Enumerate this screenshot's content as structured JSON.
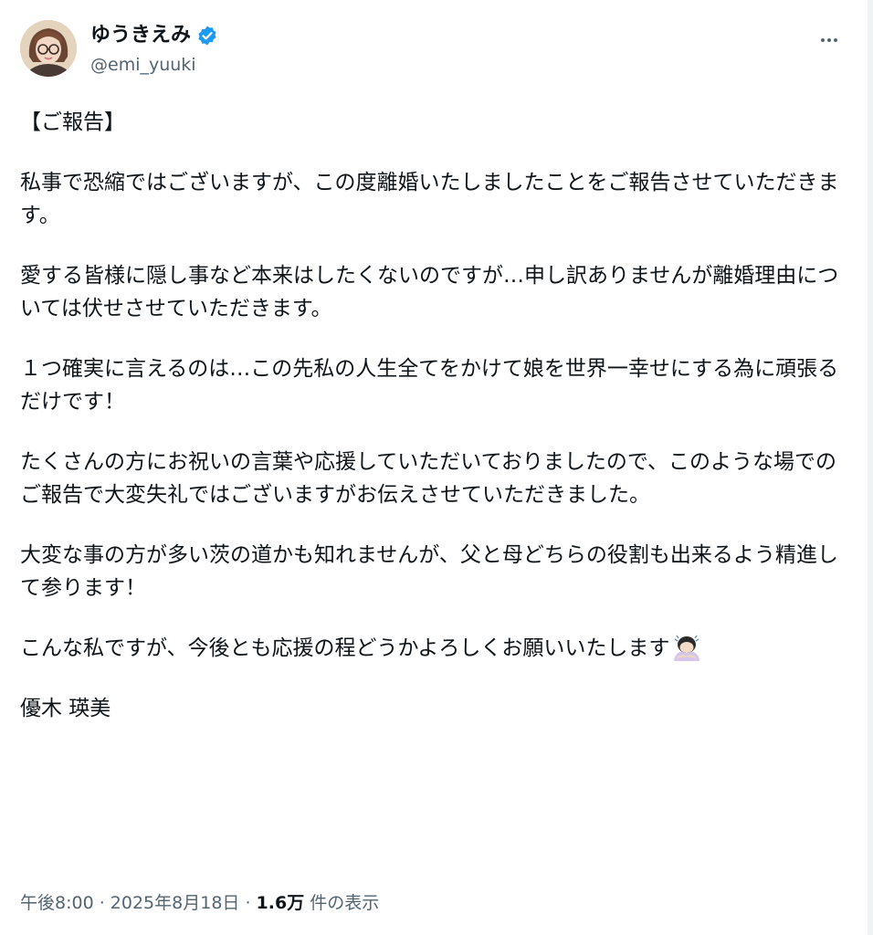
{
  "author": {
    "display_name": "ゆうきえみ",
    "handle": "@emi_yuuki",
    "avatar_icon": "profile-photo",
    "verified_icon": "verified-badge-icon",
    "verified_color": "#1d9bf0"
  },
  "menu": {
    "icon": "more-options-icon"
  },
  "post": {
    "heading": "【ご報告】",
    "paragraphs": [
      "私事で恐縮ではございますが、この度離婚いたしましたことをご報告させていただきます。",
      "愛する皆様に隠し事など本来はしたくないのですが…申し訳ありませんが離婚理由については伏せさせていただきます。",
      "１つ確実に言えるのは…この先私の人生全てをかけて娘を世界一幸せにする為に頑張るだけです！",
      "たくさんの方にお祝いの言葉や応援していただいておりましたので、このような場でのご報告で大変失礼ではございますがお伝えさせていただきました。",
      "大変な事の方が多い茨の道かも知れませんが、父と母どちらの役割も出来るよう精進して参ります！"
    ],
    "closing": "こんな私ですが、今後とも応援の程どうかよろしくお願いいたします",
    "closing_emoji": "person-bowing-emoji",
    "signature": "優木 瑛美"
  },
  "footer": {
    "time": "午後8:00",
    "separator": " · ",
    "date": "2025年8月18日",
    "views_count": "1.6万",
    "views_label": " 件の表示"
  },
  "colors": {
    "text": "#0f1419",
    "secondary": "#536471",
    "background": "#ffffff"
  }
}
